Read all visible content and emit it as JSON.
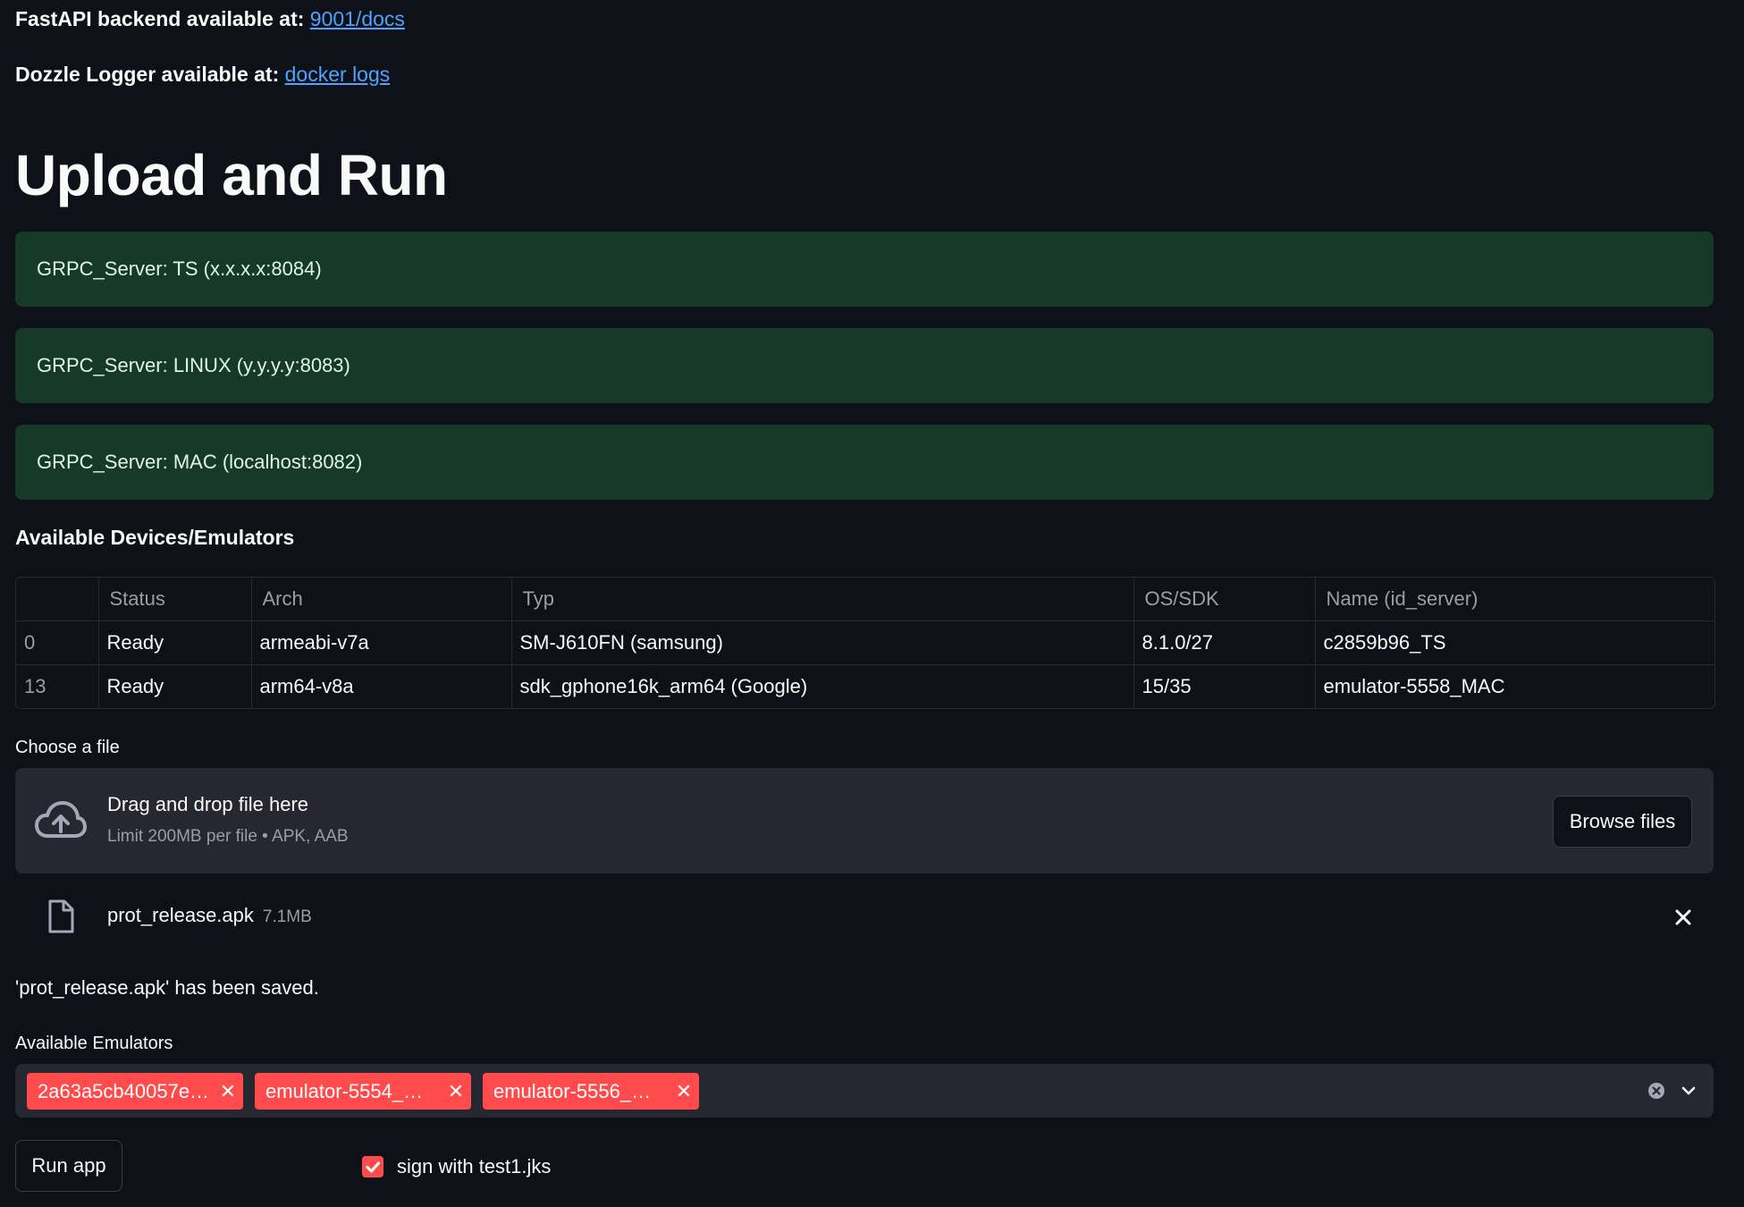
{
  "links": {
    "fastapi_label": "FastAPI backend available at:",
    "fastapi_link": "9001/docs",
    "dozzle_label": "Dozzle Logger available at:",
    "dozzle_link": "docker logs"
  },
  "title": "Upload and Run",
  "servers": [
    "GRPC_Server: TS (x.x.x.x:8084)",
    "GRPC_Server: LINUX (y.y.y.y:8083)",
    "GRPC_Server: MAC (localhost:8082)"
  ],
  "devices": {
    "heading": "Available Devices/Emulators",
    "columns": [
      "",
      "Status",
      "Arch",
      "Typ",
      "OS/SDK",
      "Name (id_server)"
    ],
    "rows": [
      [
        "0",
        "Ready",
        "armeabi-v7a",
        "SM-J610FN (samsung)",
        "8.1.0/27",
        "c2859b96_TS"
      ],
      [
        "13",
        "Ready",
        "arm64-v8a",
        "sdk_gphone16k_arm64 (Google)",
        "15/35",
        "emulator-5558_MAC"
      ]
    ]
  },
  "uploader": {
    "label": "Choose a file",
    "drag_text": "Drag and drop file here",
    "limit_text": "Limit 200MB per file • APK, AAB",
    "browse_label": "Browse files",
    "file_name": "prot_release.apk",
    "file_size": "7.1MB",
    "upload_icon": "cloud-upload-icon",
    "file_icon": "file-icon"
  },
  "saved_message": "'prot_release.apk' has been saved.",
  "emulators": {
    "label": "Available Emulators",
    "selected": [
      "2a63a5cb40057e…",
      "emulator-5554_…",
      "emulator-5556_…"
    ],
    "chip_color": "#ff4b4b"
  },
  "run_button": "Run app",
  "sign_checkbox": {
    "label": "sign with test1.jks",
    "checked": true
  },
  "colors": {
    "background": "#0e1117",
    "server_box": "#173928",
    "accent": "#ff4b4b",
    "link": "#4da3ff"
  }
}
